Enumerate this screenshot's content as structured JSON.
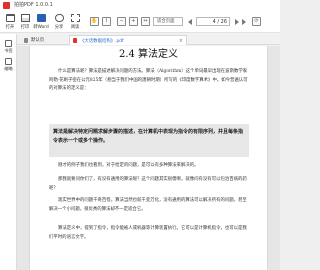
{
  "window": {
    "title": "拍拍PDF 1.0.0.1"
  },
  "toolbar": {
    "tools": [
      {
        "label": "打开",
        "icon": "open-icon"
      },
      {
        "label": "打印",
        "icon": "print-icon"
      },
      {
        "label": "转Word",
        "icon": "word-icon"
      },
      {
        "label": "分享",
        "icon": "share-icon"
      },
      {
        "label": "阅读",
        "icon": "view-icon"
      }
    ],
    "zoom_value": "适合页面",
    "page_current": "4",
    "page_total": "/ 26"
  },
  "leftnav": {
    "items": [
      {
        "label": "书签",
        "icon": "bookmark-icon"
      },
      {
        "label": "缩略",
        "icon": "thumbnail-icon"
      }
    ]
  },
  "tabs": [
    {
      "label": "默认页",
      "active": false
    },
    {
      "label": "《大话数据结构》.pdf",
      "active": true
    }
  ],
  "document": {
    "section_title": "2.4  算法定义",
    "paragraphs": [
      "什么是算法呢？算法是描述解决问题的方法。算法（Algorithm）这个单词最早出现在波斯数学家阿勒·花剌子密在公元825年（相当于我们中国的唐朝时期）所写的《印度数字算术》中。如今普遍认可的对算法的定义是：",
      "刚才的例子我们也看到，对于给定的问题，是可以有多种算法来解决的。",
      "那我就要问你们了，有没有通用的算法呢？这个问题其实很傻啊，就像问有没有可以包治百病的药呢？",
      "现实世界中的问题千奇百怪，算法当然也就千变万化，没有通用的算法可以解决所有的问题。甚至解决一个小问题，很优秀的算法却不一定适合它。",
      "算法定义中，提到了指令，指令能被人或机器等计算装置执行。它可以是计算机指令，也可以是我们平时的语言文字。"
    ],
    "definition": "算法是解决特定问题求解步骤的描述，在计算机中表现为指令的有限序列，并且每条指令表示一个或多个操作。"
  }
}
